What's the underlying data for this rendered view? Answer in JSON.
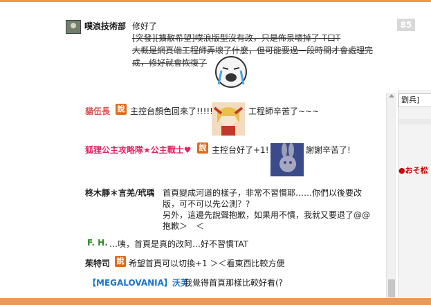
{
  "header": {
    "author": "噗浪技術部",
    "title": "修好了",
    "post_number": "85",
    "lines": [
      "[突發][擴散希望]噗浪版型沒有改，只是佈景壞掉了 T口T",
      "大概是網頁端工程師弄壞了什麼，但可能要過一段時間才會處理完",
      "成，修好就會恢復了"
    ]
  },
  "sidebar": {
    "item1": "劉兵]",
    "item2": "●おそ松"
  },
  "comments": [
    {
      "name": "貓伍長",
      "say": "說",
      "text": "主控台顏色回來了!!!!!",
      "text2": "工程師辛苦了~~~"
    },
    {
      "name": "狐狸公主攻略隊★公主戰士♥",
      "say": "說",
      "text": "主控台好了+1!",
      "text2": "謝謝辛苦了!"
    },
    {
      "name": "柊木靜＊言羌/玳瑀",
      "lines": [
        "首頁變成河道的樣子，非常不習慣耶……你們以後要改",
        "版，可不可以先公測？?",
        "另外，這邊先說聲抱歉，如果用不慣，我就又要退了@@",
        "抱歉＞　＜"
      ]
    },
    {
      "name": "F. H.",
      "text": "…咦，首頁是真的改阿…好不習慣TAT"
    },
    {
      "name": "茱特司",
      "say": "說",
      "text": "希望首頁可以切換+1 ＞＜看東西比較方便"
    },
    {
      "name": "【MEGALOVANIA】沃芙",
      "text": "我覺得首頁那樣比較好看(?"
    }
  ]
}
